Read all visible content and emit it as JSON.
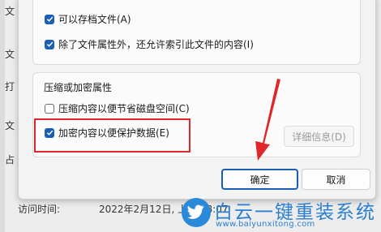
{
  "background_window": {
    "stub_chars": [
      "文",
      "文",
      "打",
      "文",
      "占",
      "访"
    ],
    "access_time_label": "访问时间:",
    "access_time_value": "2022年2月12日, 上午 58:07"
  },
  "dialog": {
    "archive_group": {
      "checkbox_archive": {
        "label": "可以存档文件(A)",
        "checked": true
      },
      "checkbox_index": {
        "label": "除了文件属性外，还允许索引此文件的内容(I)",
        "checked": true
      }
    },
    "compress_group": {
      "title": "压缩或加密属性",
      "checkbox_compress": {
        "label": "压缩内容以便节省磁盘空间(C)",
        "checked": false
      },
      "checkbox_encrypt": {
        "label": "加密内容以便保护数据(E)",
        "checked": true
      },
      "details_button": "详细信息(D)"
    },
    "ok_button": "确定",
    "cancel_button": "取消"
  },
  "watermark": {
    "title": "白云一键重装系统",
    "url": "www.baiyunxitong.com"
  },
  "colors": {
    "accent": "#1a5fb4",
    "highlight": "#e0262a",
    "watermark": "#2a7fd0"
  }
}
